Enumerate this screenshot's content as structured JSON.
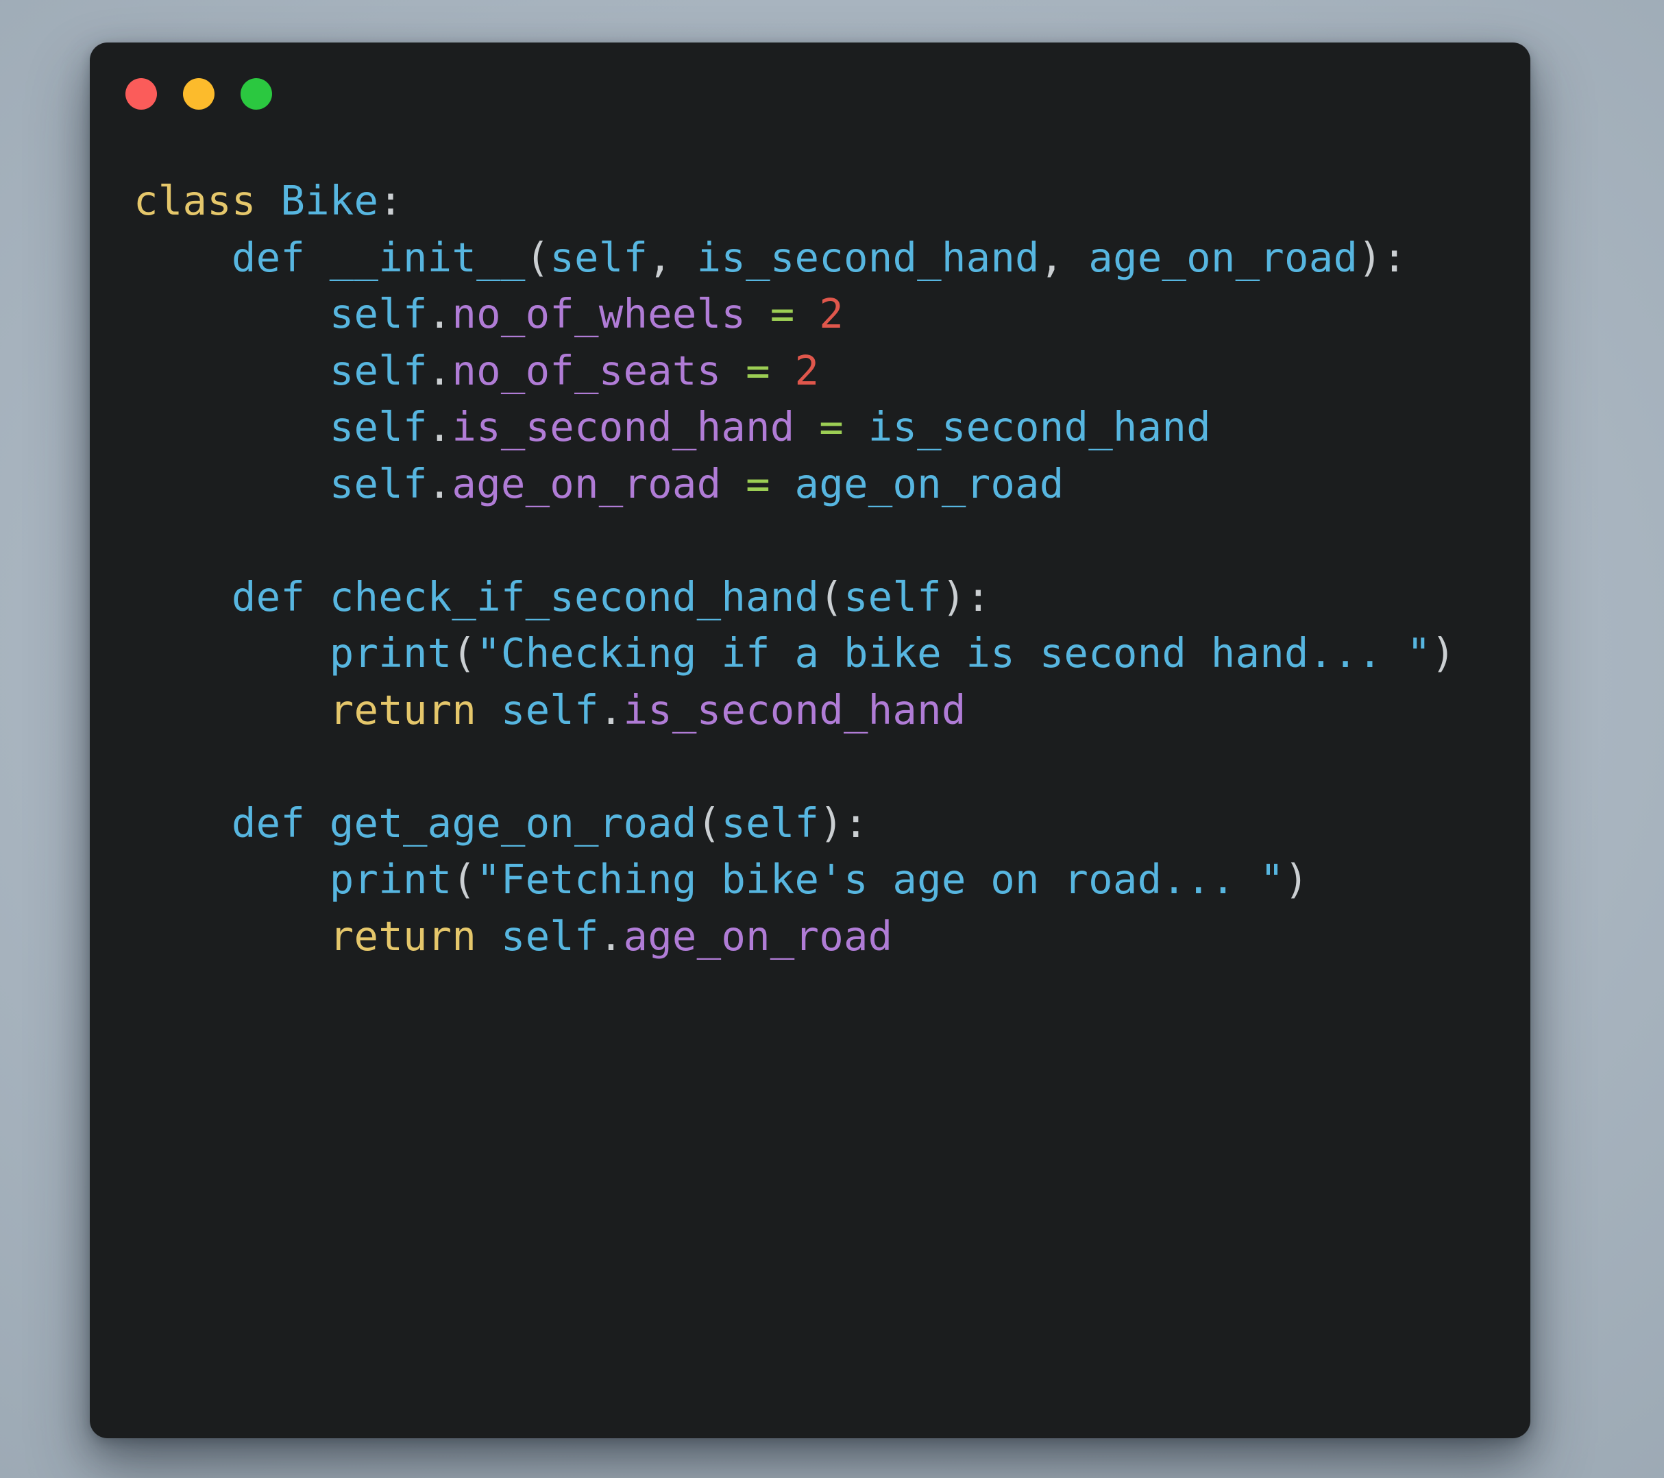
{
  "window": {
    "background_color": "#1b1d1e",
    "page_background_color": "#a9b5c0",
    "traffic_lights": [
      {
        "name": "close",
        "color": "#fb5c5a"
      },
      {
        "name": "minimize",
        "color": "#fcbb2c"
      },
      {
        "name": "maximize",
        "color": "#2bc840"
      }
    ]
  },
  "syntax_colors": {
    "keyword": "#e5c76b",
    "identifier": "#57b6e0",
    "attribute": "#b07cd6",
    "operator": "#9cce54",
    "number": "#e0574c",
    "punctuation": "#cbcfd2"
  },
  "code": {
    "language": "python",
    "full_text": "class Bike:\n    def __init__(self, is_second_hand, age_on_road):\n        self.no_of_wheels = 2\n        self.no_of_seats = 2\n        self.is_second_hand = is_second_hand\n        self.age_on_road = age_on_road\n\n    def check_if_second_hand(self):\n        print(\"Checking if a bike is second hand... \")\n        return self.is_second_hand\n\n    def get_age_on_road(self):\n        print(\"Fetching bike's age on road... \")\n        return self.age_on_road",
    "lines": [
      {
        "n": 1,
        "indent": "",
        "tokens": [
          {
            "t": "class",
            "c": "kw"
          },
          {
            "t": " ",
            "c": "punc"
          },
          {
            "t": "Bike",
            "c": "name"
          },
          {
            "t": ":",
            "c": "punc"
          }
        ]
      },
      {
        "n": 2,
        "indent": "    ",
        "tokens": [
          {
            "t": "def",
            "c": "name"
          },
          {
            "t": " ",
            "c": "punc"
          },
          {
            "t": "__init__",
            "c": "name"
          },
          {
            "t": "(",
            "c": "punc"
          },
          {
            "t": "self",
            "c": "name"
          },
          {
            "t": ",",
            "c": "punc"
          },
          {
            "t": " ",
            "c": "punc"
          },
          {
            "t": "is_second_hand",
            "c": "name"
          },
          {
            "t": ",",
            "c": "punc"
          },
          {
            "t": " ",
            "c": "punc"
          },
          {
            "t": "age_on_road",
            "c": "name"
          },
          {
            "t": ")",
            "c": "punc"
          },
          {
            "t": ":",
            "c": "punc"
          }
        ]
      },
      {
        "n": 3,
        "indent": "        ",
        "tokens": [
          {
            "t": "self",
            "c": "name"
          },
          {
            "t": ".",
            "c": "punc"
          },
          {
            "t": "no_of_wheels",
            "c": "attr"
          },
          {
            "t": " ",
            "c": "punc"
          },
          {
            "t": "=",
            "c": "op"
          },
          {
            "t": " ",
            "c": "punc"
          },
          {
            "t": "2",
            "c": "num"
          }
        ]
      },
      {
        "n": 4,
        "indent": "        ",
        "tokens": [
          {
            "t": "self",
            "c": "name"
          },
          {
            "t": ".",
            "c": "punc"
          },
          {
            "t": "no_of_seats",
            "c": "attr"
          },
          {
            "t": " ",
            "c": "punc"
          },
          {
            "t": "=",
            "c": "op"
          },
          {
            "t": " ",
            "c": "punc"
          },
          {
            "t": "2",
            "c": "num"
          }
        ]
      },
      {
        "n": 5,
        "indent": "        ",
        "tokens": [
          {
            "t": "self",
            "c": "name"
          },
          {
            "t": ".",
            "c": "punc"
          },
          {
            "t": "is_second_hand",
            "c": "attr"
          },
          {
            "t": " ",
            "c": "punc"
          },
          {
            "t": "=",
            "c": "op"
          },
          {
            "t": " ",
            "c": "punc"
          },
          {
            "t": "is_second_hand",
            "c": "name"
          }
        ]
      },
      {
        "n": 6,
        "indent": "        ",
        "tokens": [
          {
            "t": "self",
            "c": "name"
          },
          {
            "t": ".",
            "c": "punc"
          },
          {
            "t": "age_on_road",
            "c": "attr"
          },
          {
            "t": " ",
            "c": "punc"
          },
          {
            "t": "=",
            "c": "op"
          },
          {
            "t": " ",
            "c": "punc"
          },
          {
            "t": "age_on_road",
            "c": "name"
          }
        ]
      },
      {
        "n": 7,
        "indent": "",
        "tokens": []
      },
      {
        "n": 8,
        "indent": "    ",
        "tokens": [
          {
            "t": "def",
            "c": "name"
          },
          {
            "t": " ",
            "c": "punc"
          },
          {
            "t": "check_if_second_hand",
            "c": "name"
          },
          {
            "t": "(",
            "c": "punc"
          },
          {
            "t": "self",
            "c": "name"
          },
          {
            "t": ")",
            "c": "punc"
          },
          {
            "t": ":",
            "c": "punc"
          }
        ]
      },
      {
        "n": 9,
        "indent": "        ",
        "tokens": [
          {
            "t": "print",
            "c": "name"
          },
          {
            "t": "(",
            "c": "punc"
          },
          {
            "t": "\"Checking if a bike is second hand... \"",
            "c": "name"
          },
          {
            "t": ")",
            "c": "punc"
          }
        ]
      },
      {
        "n": 10,
        "indent": "        ",
        "tokens": [
          {
            "t": "return",
            "c": "kw"
          },
          {
            "t": " ",
            "c": "punc"
          },
          {
            "t": "self",
            "c": "name"
          },
          {
            "t": ".",
            "c": "punc"
          },
          {
            "t": "is_second_hand",
            "c": "attr"
          }
        ]
      },
      {
        "n": 11,
        "indent": "",
        "tokens": []
      },
      {
        "n": 12,
        "indent": "    ",
        "tokens": [
          {
            "t": "def",
            "c": "name"
          },
          {
            "t": " ",
            "c": "punc"
          },
          {
            "t": "get_age_on_road",
            "c": "name"
          },
          {
            "t": "(",
            "c": "punc"
          },
          {
            "t": "self",
            "c": "name"
          },
          {
            "t": ")",
            "c": "punc"
          },
          {
            "t": ":",
            "c": "punc"
          }
        ]
      },
      {
        "n": 13,
        "indent": "        ",
        "tokens": [
          {
            "t": "print",
            "c": "name"
          },
          {
            "t": "(",
            "c": "punc"
          },
          {
            "t": "\"Fetching bike's age on road... \"",
            "c": "name"
          },
          {
            "t": ")",
            "c": "punc"
          }
        ]
      },
      {
        "n": 14,
        "indent": "        ",
        "tokens": [
          {
            "t": "return",
            "c": "kw"
          },
          {
            "t": " ",
            "c": "punc"
          },
          {
            "t": "self",
            "c": "name"
          },
          {
            "t": ".",
            "c": "punc"
          },
          {
            "t": "age_on_road",
            "c": "attr"
          }
        ]
      }
    ]
  }
}
